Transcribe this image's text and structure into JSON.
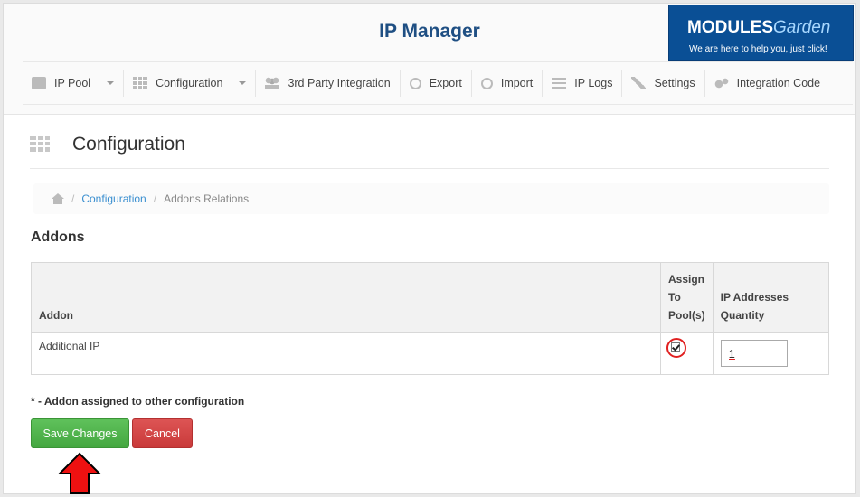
{
  "header": {
    "app_title": "IP Manager",
    "logo": {
      "brand_main": "MODULES",
      "brand_accent": "Garden",
      "tagline": "We are here to help you, just click!",
      "bg_color": "#0a4f95"
    }
  },
  "nav": {
    "items": [
      {
        "label": "IP Pool",
        "icon": "briefcase-icon",
        "has_dropdown": true
      },
      {
        "label": "Configuration",
        "icon": "grid-icon",
        "has_dropdown": true
      },
      {
        "label": "3rd Party Integration",
        "icon": "users-icon",
        "has_dropdown": false
      },
      {
        "label": "Export",
        "icon": "download-icon",
        "has_dropdown": false
      },
      {
        "label": "Import",
        "icon": "upload-icon",
        "has_dropdown": false
      },
      {
        "label": "IP Logs",
        "icon": "list-icon",
        "has_dropdown": false
      },
      {
        "label": "Settings",
        "icon": "wrench-icon",
        "has_dropdown": false
      },
      {
        "label": "Integration Code",
        "icon": "gears-icon",
        "has_dropdown": false
      }
    ]
  },
  "page": {
    "title": "Configuration"
  },
  "breadcrumb": {
    "home_icon": "home-icon",
    "sep": "/",
    "items": [
      {
        "label": "Configuration",
        "link": true
      },
      {
        "label": "Addons Relations",
        "link": false
      }
    ]
  },
  "addons": {
    "section_title": "Addons",
    "columns": [
      "Addon",
      "Assign To Pool(s)",
      "IP Addresses Quantity"
    ],
    "column_lines": {
      "assign": [
        "Assign",
        "To",
        "Pool(s)"
      ],
      "quantity": [
        "IP Addresses",
        "Quantity"
      ]
    },
    "rows": [
      {
        "addon": "Additional IP",
        "assigned": true,
        "quantity": "1"
      }
    ],
    "note": "* - Addon assigned to other configuration"
  },
  "actions": {
    "save_label": "Save Changes",
    "cancel_label": "Cancel"
  },
  "colors": {
    "title_blue": "#1f4f83",
    "link_blue": "#3a8fd0",
    "save_green": "#4cae48",
    "cancel_red": "#d04545",
    "annotation_red": "#e02020"
  }
}
